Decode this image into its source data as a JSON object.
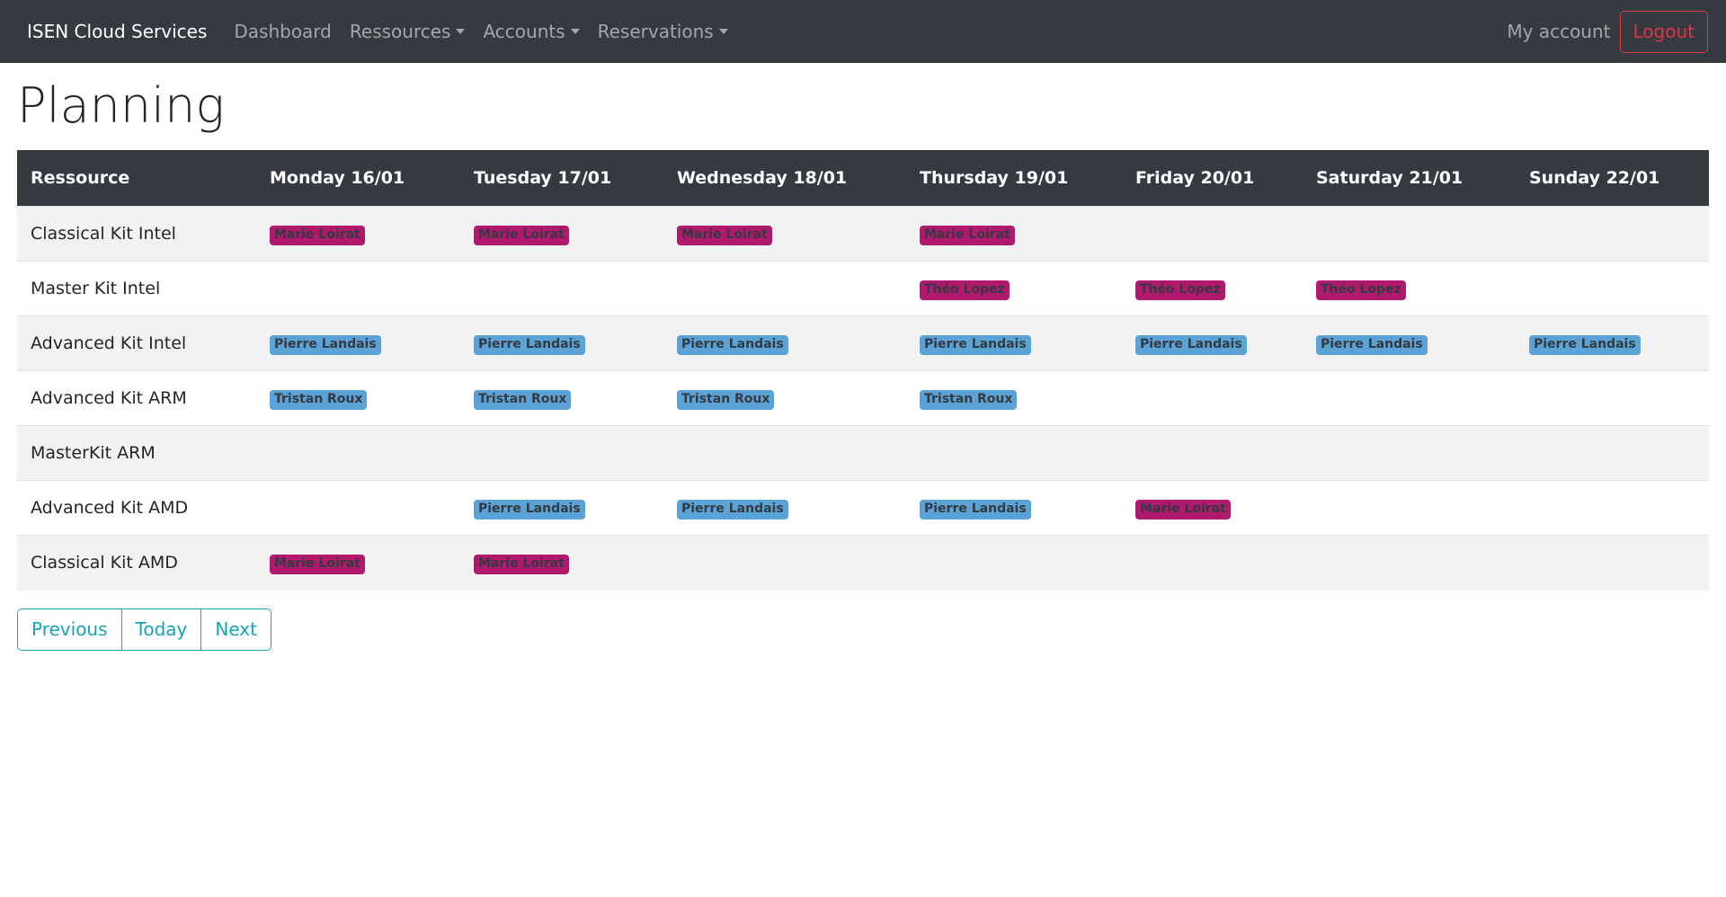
{
  "navbar": {
    "brand": "ISEN Cloud Services",
    "links": [
      {
        "label": "Dashboard",
        "dropdown": false
      },
      {
        "label": "Ressources",
        "dropdown": true
      },
      {
        "label": "Accounts",
        "dropdown": true
      },
      {
        "label": "Reservations",
        "dropdown": true
      }
    ],
    "my_account": "My account",
    "logout": "Logout"
  },
  "page": {
    "title": "Planning"
  },
  "colors": {
    "navbar_bg": "#343a40",
    "badge_magenta": "#b0196e",
    "badge_blue": "#5ba3d6",
    "logout_red": "#dc3545",
    "pagination_teal": "#17a2b8",
    "row_stripe": "#f2f2f2"
  },
  "planning": {
    "columns": [
      "Ressource",
      "Monday 16/01",
      "Tuesday 17/01",
      "Wednesday 18/01",
      "Thursday 19/01",
      "Friday 20/01",
      "Saturday 21/01",
      "Sunday 22/01"
    ],
    "rows": [
      {
        "resource": "Classical Kit Intel",
        "cells": [
          {
            "name": "Marie Loirat",
            "color": "magenta"
          },
          {
            "name": "Marie Loirat",
            "color": "magenta"
          },
          {
            "name": "Marie Loirat",
            "color": "magenta"
          },
          {
            "name": "Marie Loirat",
            "color": "magenta"
          },
          null,
          null,
          null
        ]
      },
      {
        "resource": "Master Kit Intel",
        "cells": [
          null,
          null,
          null,
          {
            "name": "Théo Lopez",
            "color": "magenta"
          },
          {
            "name": "Théo Lopez",
            "color": "magenta"
          },
          {
            "name": "Théo Lopez",
            "color": "magenta"
          },
          null
        ]
      },
      {
        "resource": "Advanced Kit Intel",
        "cells": [
          {
            "name": "Pierre Landais",
            "color": "blue"
          },
          {
            "name": "Pierre Landais",
            "color": "blue"
          },
          {
            "name": "Pierre Landais",
            "color": "blue"
          },
          {
            "name": "Pierre Landais",
            "color": "blue"
          },
          {
            "name": "Pierre Landais",
            "color": "blue"
          },
          {
            "name": "Pierre Landais",
            "color": "blue"
          },
          {
            "name": "Pierre Landais",
            "color": "blue"
          }
        ]
      },
      {
        "resource": "Advanced Kit ARM",
        "cells": [
          {
            "name": "Tristan Roux",
            "color": "blue"
          },
          {
            "name": "Tristan Roux",
            "color": "blue"
          },
          {
            "name": "Tristan Roux",
            "color": "blue"
          },
          {
            "name": "Tristan Roux",
            "color": "blue"
          },
          null,
          null,
          null
        ]
      },
      {
        "resource": "MasterKit ARM",
        "cells": [
          null,
          null,
          null,
          null,
          null,
          null,
          null
        ]
      },
      {
        "resource": "Advanced Kit AMD",
        "cells": [
          null,
          {
            "name": "Pierre Landais",
            "color": "blue"
          },
          {
            "name": "Pierre Landais",
            "color": "blue"
          },
          {
            "name": "Pierre Landais",
            "color": "blue"
          },
          {
            "name": "Marie Loirat",
            "color": "magenta"
          },
          null,
          null
        ]
      },
      {
        "resource": "Classical Kit AMD",
        "cells": [
          {
            "name": "Marie Loirat",
            "color": "magenta"
          },
          {
            "name": "Marie Loirat",
            "color": "magenta"
          },
          null,
          null,
          null,
          null,
          null
        ]
      }
    ]
  },
  "pagination": {
    "previous": "Previous",
    "today": "Today",
    "next": "Next"
  }
}
